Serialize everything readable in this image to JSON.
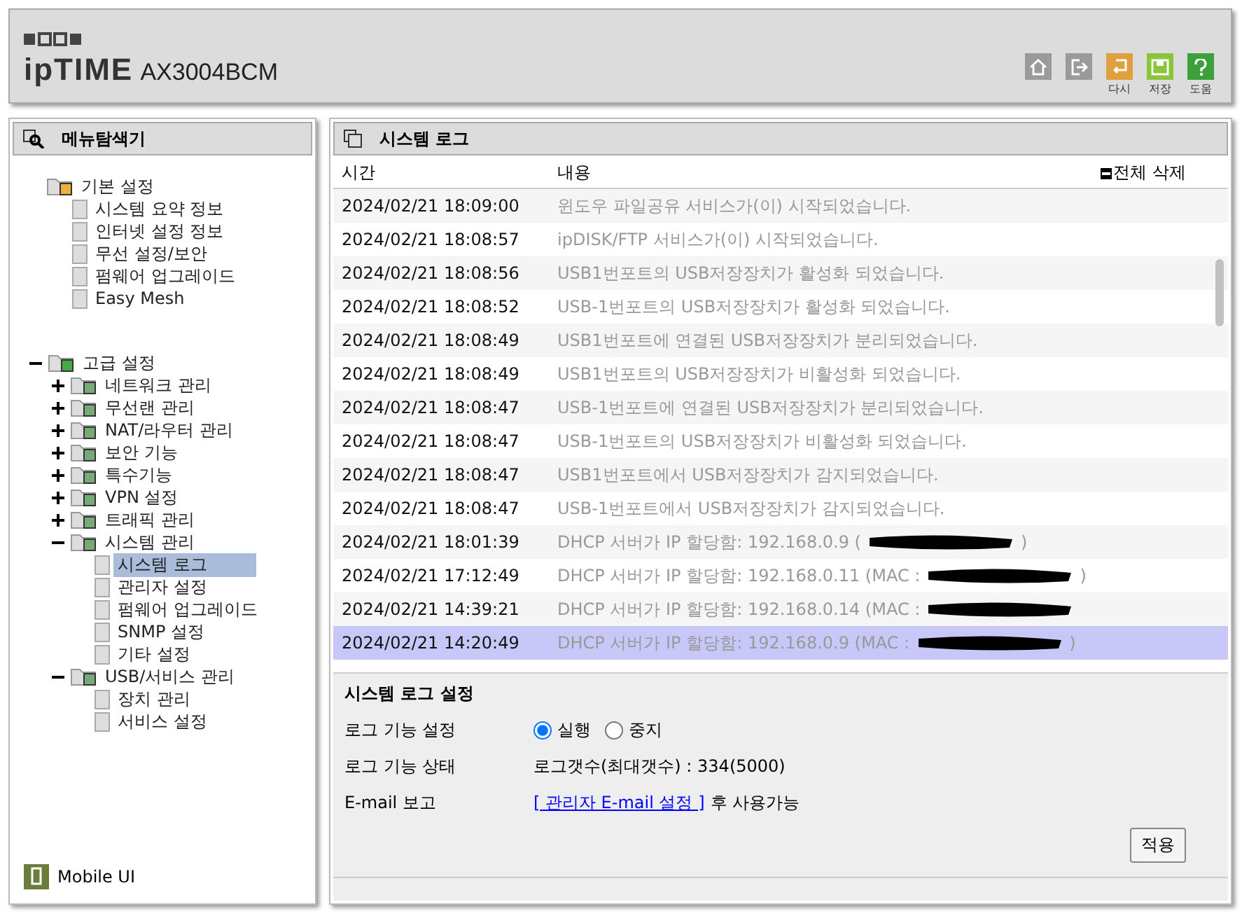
{
  "header": {
    "brand": "ipTIME",
    "model": "AX3004BCM",
    "actions": [
      {
        "kind": "home"
      },
      {
        "kind": "logout"
      },
      {
        "kind": "reload",
        "label": "다시"
      },
      {
        "kind": "save",
        "label": "저장"
      },
      {
        "kind": "help",
        "label": "도움"
      }
    ]
  },
  "sidebar": {
    "title": "메뉴탐색기",
    "groups": [
      {
        "label": "기본 설정",
        "children": [
          {
            "label": "시스템 요약 정보",
            "selected": false
          },
          {
            "label": "인터넷 설정 정보",
            "selected": false
          },
          {
            "label": "무선 설정/보안",
            "selected": false
          },
          {
            "label": "펌웨어 업그레이드",
            "selected": false
          },
          {
            "label": "Easy Mesh",
            "selected": false
          }
        ]
      },
      {
        "label": "고급 설정",
        "expanded": true,
        "children": [
          {
            "label": "네트워크 관리",
            "kind": "folder",
            "expanded": false
          },
          {
            "label": "무선랜 관리",
            "kind": "folder",
            "expanded": false
          },
          {
            "label": "NAT/라우터 관리",
            "kind": "folder",
            "expanded": false
          },
          {
            "label": "보안 기능",
            "kind": "folder",
            "expanded": false
          },
          {
            "label": "특수기능",
            "kind": "folder",
            "expanded": false
          },
          {
            "label": "VPN 설정",
            "kind": "folder",
            "expanded": false
          },
          {
            "label": "트래픽 관리",
            "kind": "folder",
            "expanded": false
          },
          {
            "label": "시스템 관리",
            "kind": "folder",
            "expanded": true,
            "children": [
              {
                "label": "시스템 로그",
                "selected": true
              },
              {
                "label": "관리자 설정",
                "selected": false
              },
              {
                "label": "펌웨어 업그레이드",
                "selected": false
              },
              {
                "label": "SNMP 설정",
                "selected": false
              },
              {
                "label": "기타 설정",
                "selected": false
              }
            ]
          },
          {
            "label": "USB/서비스 관리",
            "kind": "folder",
            "expanded": true,
            "children": [
              {
                "label": "장치 관리",
                "selected": false
              },
              {
                "label": "서비스 설정",
                "selected": false
              }
            ]
          }
        ]
      }
    ],
    "footer": "Mobile UI"
  },
  "main": {
    "title": "시스템 로그",
    "table": {
      "columns": [
        "시간",
        "내용"
      ],
      "delete_all": "전체 삭제",
      "rows": [
        {
          "time": "2024/02/21 18:09:00",
          "message": "윈도우 파일공유 서비스가(이) 시작되었습니다.",
          "selected": false
        },
        {
          "time": "2024/02/21 18:08:57",
          "message": "ipDISK/FTP 서비스가(이) 시작되었습니다.",
          "selected": false
        },
        {
          "time": "2024/02/21 18:08:56",
          "message": "USB1번포트의 USB저장장치가 활성화 되었습니다.",
          "selected": false
        },
        {
          "time": "2024/02/21 18:08:52",
          "message": "USB-1번포트의 USB저장장치가 활성화 되었습니다.",
          "selected": false
        },
        {
          "time": "2024/02/21 18:08:49",
          "message": "USB1번포트에 연결된 USB저장장치가 분리되었습니다.",
          "selected": false
        },
        {
          "time": "2024/02/21 18:08:49",
          "message": "USB1번포트의 USB저장장치가 비활성화 되었습니다.",
          "selected": false
        },
        {
          "time": "2024/02/21 18:08:47",
          "message": "USB-1번포트에 연결된 USB저장장치가 분리되었습니다.",
          "selected": false
        },
        {
          "time": "2024/02/21 18:08:47",
          "message": "USB-1번포트의 USB저장장치가 비활성화 되었습니다.",
          "selected": false
        },
        {
          "time": "2024/02/21 18:08:47",
          "message": "USB1번포트에서 USB저장장치가 감지되었습니다.",
          "selected": false
        },
        {
          "time": "2024/02/21 18:08:47",
          "message": "USB-1번포트에서 USB저장장치가 감지되었습니다.",
          "selected": false
        },
        {
          "time": "2024/02/21 18:01:39",
          "message": "DHCP 서버가 IP 할당함: 192.168.0.9 (",
          "redacted": true,
          "tail": ")",
          "selected": false
        },
        {
          "time": "2024/02/21 17:12:49",
          "message": "DHCP 서버가 IP 할당함: 192.168.0.11 (MAC :",
          "redacted": true,
          "tail": ")",
          "selected": false
        },
        {
          "time": "2024/02/21 14:39:21",
          "message": "DHCP 서버가 IP 할당함: 192.168.0.14 (MAC :",
          "redacted": true,
          "selected": false
        },
        {
          "time": "2024/02/21 14:20:49",
          "message": "DHCP 서버가 IP 할당함: 192.168.0.9 (MAC :",
          "redacted": true,
          "tail": ")",
          "selected": true
        }
      ]
    },
    "settings": {
      "title": "시스템 로그 설정",
      "rows": [
        {
          "kind": "radio",
          "label": "로그 기능 설정",
          "options": [
            {
              "label": "실행",
              "selected": true
            },
            {
              "label": "중지",
              "selected": false
            }
          ]
        },
        {
          "kind": "text",
          "label": "로그 기능 상태",
          "value": "로그갯수(최대갯수) : 334(5000)"
        },
        {
          "kind": "link",
          "label": "E-mail 보고",
          "link": "[ 관리자 E-mail 설정 ]",
          "value": "후 사용가능"
        }
      ],
      "apply": "적용"
    }
  }
}
